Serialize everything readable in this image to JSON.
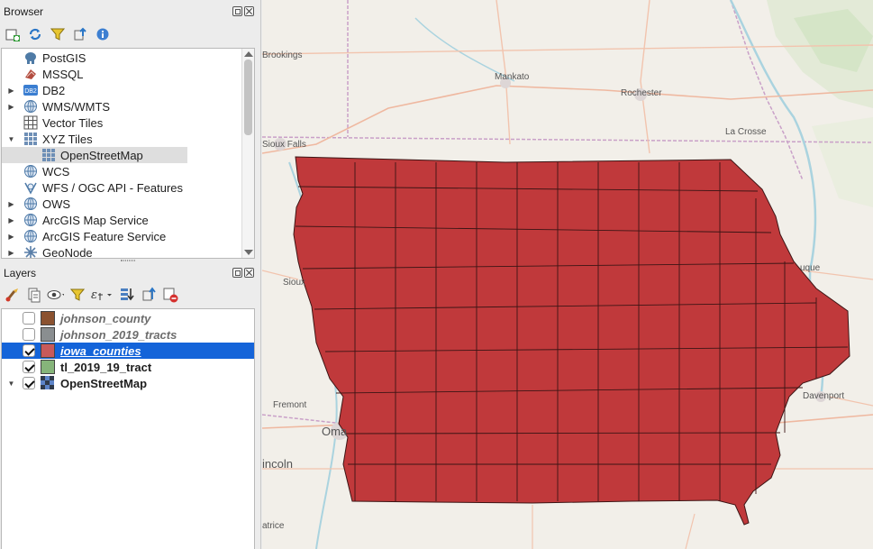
{
  "browser": {
    "title": "Browser",
    "items": [
      {
        "label": "PostGIS",
        "icon": "postgis-elephant-icon",
        "expandable": false
      },
      {
        "label": "MSSQL",
        "icon": "mssql-icon",
        "expandable": false
      },
      {
        "label": "DB2",
        "icon": "db2-icon",
        "expandable": true
      },
      {
        "label": "WMS/WMTS",
        "icon": "globe-icon",
        "expandable": true
      },
      {
        "label": "Vector Tiles",
        "icon": "grid-icon",
        "expandable": false
      },
      {
        "label": "XYZ Tiles",
        "icon": "grid-icon",
        "expandable": true,
        "expanded": true
      },
      {
        "label": "OpenStreetMap",
        "icon": "grid-icon",
        "child": true,
        "selected": true
      },
      {
        "label": "WCS",
        "icon": "globe-icon",
        "expandable": false
      },
      {
        "label": "WFS / OGC API - Features",
        "icon": "wfs-icon",
        "expandable": false
      },
      {
        "label": "OWS",
        "icon": "globe-icon",
        "expandable": true
      },
      {
        "label": "ArcGIS Map Service",
        "icon": "globe-icon",
        "expandable": true
      },
      {
        "label": "ArcGIS Feature Service",
        "icon": "globe-icon",
        "expandable": true
      },
      {
        "label": "GeoNode",
        "icon": "geonode-icon",
        "expandable": true
      }
    ]
  },
  "layers": {
    "title": "Layers",
    "items": [
      {
        "label": "johnson_county",
        "checked": false,
        "swatch": "#8b5230",
        "style": "italic"
      },
      {
        "label": "johnson_2019_tracts",
        "checked": false,
        "swatch": "#8a8e90",
        "style": "italic"
      },
      {
        "label": "iowa_counties",
        "checked": true,
        "swatch": "#c85a5a",
        "style": "selected"
      },
      {
        "label": "tl_2019_19_tract",
        "checked": true,
        "swatch": "#86b57a",
        "style": "bold"
      },
      {
        "label": "OpenStreetMap",
        "checked": true,
        "swatch": "raster",
        "style": "bold",
        "expandable": true
      }
    ]
  },
  "map": {
    "fill_color": "#c0393b",
    "cities": [
      "Brookings",
      "Mankato",
      "Rochester",
      "Sioux Falls",
      "La Crosse",
      "Sioux",
      "uque",
      "Fremont",
      "Oma",
      "Davenport",
      "incoln",
      "atrice"
    ]
  }
}
